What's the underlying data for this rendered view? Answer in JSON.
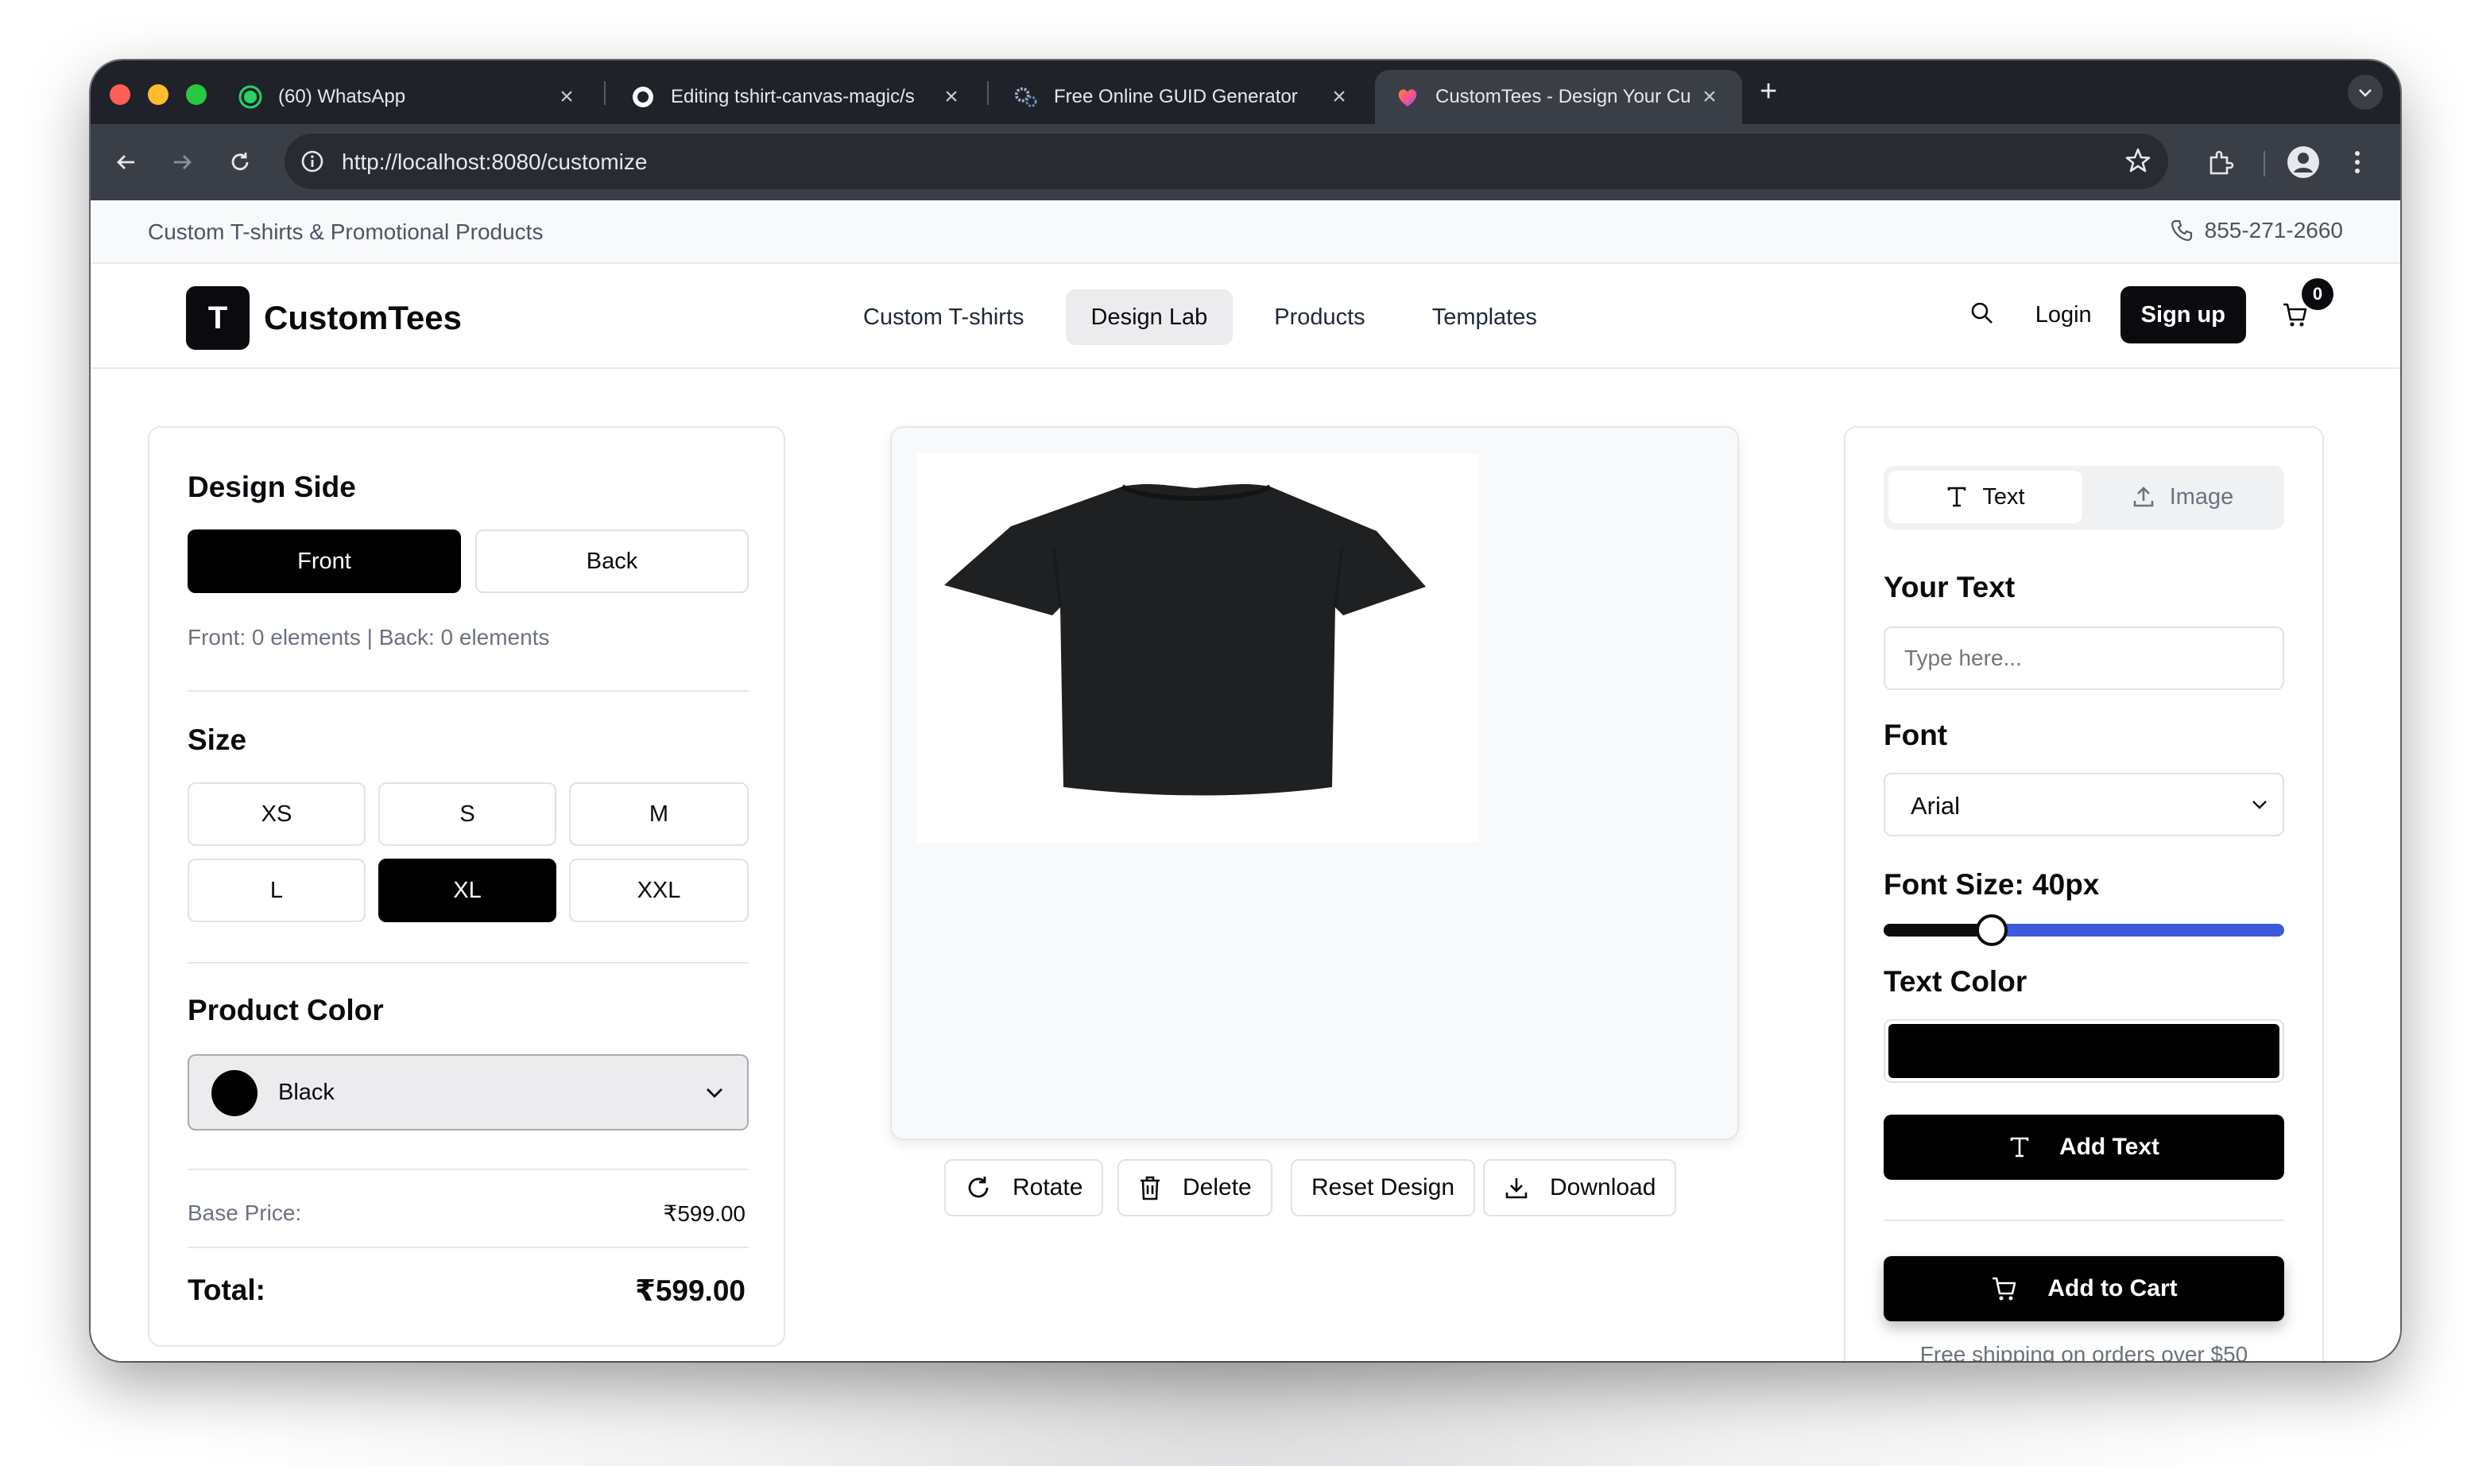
{
  "browser": {
    "tabs": [
      {
        "title": "(60) WhatsApp",
        "icon": "whatsapp-icon"
      },
      {
        "title": "Editing tshirt-canvas-magic/s",
        "icon": "github-icon"
      },
      {
        "title": "Free Online GUID Generator",
        "icon": "gears-icon"
      },
      {
        "title": "CustomTees - Design Your Cu",
        "icon": "lovable-heart-icon"
      }
    ],
    "url": "http://localhost:8080/customize"
  },
  "topbar": {
    "tagline": "Custom T-shirts & Promotional Products",
    "phone": "855-271-2660"
  },
  "header": {
    "logo_letter": "T",
    "brand": "CustomTees",
    "nav": [
      "Custom T-shirts",
      "Design Lab",
      "Products",
      "Templates"
    ],
    "login": "Login",
    "signup": "Sign up",
    "cart_count": "0"
  },
  "left_panel": {
    "design_side_title": "Design Side",
    "front": "Front",
    "back": "Back",
    "elements_info": "Front: 0 elements | Back: 0 elements",
    "size_title": "Size",
    "sizes": [
      "XS",
      "S",
      "M",
      "L",
      "XL",
      "XXL"
    ],
    "selected_size": "XL",
    "product_color_title": "Product Color",
    "product_color": "Black",
    "product_color_hex": "#000000",
    "base_price_label": "Base Price:",
    "base_price": "₹599.00",
    "total_label": "Total:",
    "total": "₹599.00"
  },
  "center": {
    "actions": [
      "Rotate",
      "Delete",
      "Reset Design",
      "Download"
    ]
  },
  "right_panel": {
    "tab_text": "Text",
    "tab_image": "Image",
    "your_text_label": "Your Text",
    "text_placeholder": "Type here...",
    "font_label": "Font",
    "font_value": "Arial",
    "font_size_label": "Font Size: 40px",
    "font_size_fraction": 0.27,
    "text_color_label": "Text Color",
    "text_color_hex": "#000000",
    "add_text": "Add Text",
    "add_to_cart": "Add to Cart",
    "shipping_note": "Free shipping on orders over $50"
  }
}
